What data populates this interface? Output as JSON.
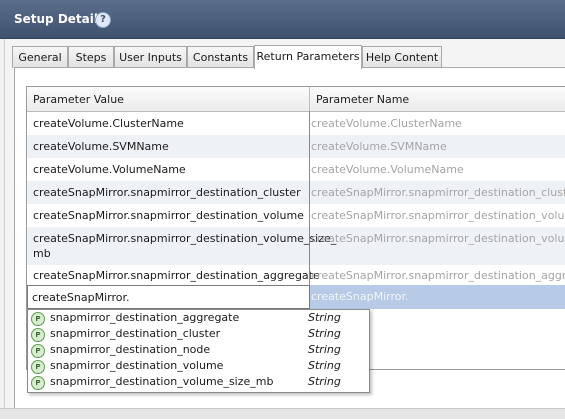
{
  "window": {
    "title": "Setup Details",
    "help_glyph": "?"
  },
  "tabs": [
    {
      "label": "General"
    },
    {
      "label": "Steps"
    },
    {
      "label": "User Inputs"
    },
    {
      "label": "Constants"
    },
    {
      "label": "Return Parameters",
      "active": true
    },
    {
      "label": "Help Content"
    }
  ],
  "table": {
    "columns": [
      "Parameter Value",
      "Parameter Name"
    ],
    "rows": [
      {
        "value": "createVolume.ClusterName",
        "name": "createVolume.ClusterName"
      },
      {
        "value": "createVolume.SVMName",
        "name": "createVolume.SVMName"
      },
      {
        "value": "createVolume.VolumeName",
        "name": "createVolume.VolumeName"
      },
      {
        "value": "createSnapMirror.snapmirror_destination_cluster",
        "name": "createSnapMirror.snapmirror_destination_cluster"
      },
      {
        "value": "createSnapMirror.snapmirror_destination_volume",
        "name": "createSnapMirror.snapmirror_destination_volume"
      },
      {
        "value_line1": "createSnapMirror.snapmirror_destination_volume_size_",
        "value_line2": "mb",
        "name": "createSnapMirror.snapmirror_destination_volume_siz"
      },
      {
        "value": "createSnapMirror.snapmirror_destination_aggregate",
        "name": "createSnapMirror.snapmirror_destination_aggregate"
      }
    ],
    "edit_row": {
      "input_value": "createSnapMirror.",
      "name": "createSnapMirror."
    }
  },
  "autocomplete": {
    "icon_text": "P",
    "items": [
      {
        "name": "snapmirror_destination_aggregate",
        "type": "String"
      },
      {
        "name": "snapmirror_destination_cluster",
        "type": "String"
      },
      {
        "name": "snapmirror_destination_node",
        "type": "String"
      },
      {
        "name": "snapmirror_destination_volume",
        "type": "String"
      },
      {
        "name": "snapmirror_destination_volume_size_mb",
        "type": "String"
      }
    ]
  },
  "colors": {
    "titlebar": "#3e5270",
    "row_alt": "#eef2f7",
    "row_selected": "#b7cbe6",
    "name_text_muted": "#a4a4a4"
  }
}
